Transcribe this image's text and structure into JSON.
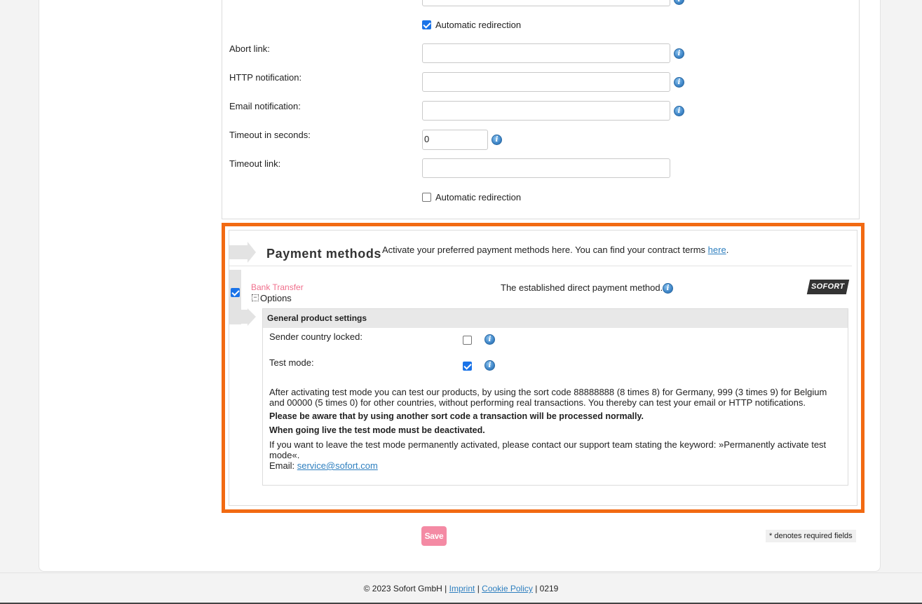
{
  "redirect_section": {
    "auto_redirect_1": {
      "label": "Automatic redirection",
      "checked": true
    },
    "abort_link": {
      "label": "Abort link:",
      "value": ""
    },
    "http_notification": {
      "label": "HTTP notification:",
      "value": ""
    },
    "email_notification": {
      "label": "Email notification:",
      "value": ""
    },
    "timeout_seconds": {
      "label": "Timeout in seconds:",
      "value": "0"
    },
    "timeout_link": {
      "label": "Timeout link:",
      "value": ""
    },
    "auto_redirect_2": {
      "label": "Automatic redirection",
      "checked": false
    }
  },
  "payment_methods": {
    "title": "Payment methods",
    "description": "Activate your preferred payment methods here. You can find your contract terms",
    "description_link": "here",
    "description_end": ".",
    "bank_transfer": {
      "name": "Bank Transfer",
      "enabled": true,
      "options_label": "Options",
      "options_toggle": "−",
      "tagline": "The established direct payment method.",
      "logo_text": "SOFORT"
    },
    "general_settings": {
      "heading": "General product settings",
      "sender_country_locked": {
        "label": "Sender country locked:",
        "checked": false
      },
      "test_mode": {
        "label": "Test mode:",
        "checked": true
      },
      "test_info_1": "After activating test mode you can test our products, by using the sort code 88888888 (8 times 8) for Germany, 999 (3 times 9) for Belgium and 00000 (5 times 0) for other countries, without performing real transactions. You thereby can test your email or HTTP notifications.",
      "test_info_2": "Please be aware that by using another sort code a transaction will be processed normally.",
      "test_info_3": "When going live the test mode must be deactivated.",
      "test_info_4": "If you want to leave the test mode permanently activated, please contact our support team stating the keyword: »Permanently activate test mode«.",
      "email_label": "Email:",
      "email_link": "service@sofort.com"
    }
  },
  "actions": {
    "save_label": "Save",
    "required_note": "* denotes required fields"
  },
  "footer": {
    "copyright": "© 2023 Sofort GmbH |",
    "imprint": "Imprint",
    "sep1": "|",
    "cookie_policy": "Cookie Policy",
    "sep2": "| 0219"
  },
  "colors": {
    "highlight_border": "#f26a12",
    "bank_transfer_name": "#f06f8c",
    "save_button": "#f48aa4",
    "link": "#2e7fbf"
  }
}
